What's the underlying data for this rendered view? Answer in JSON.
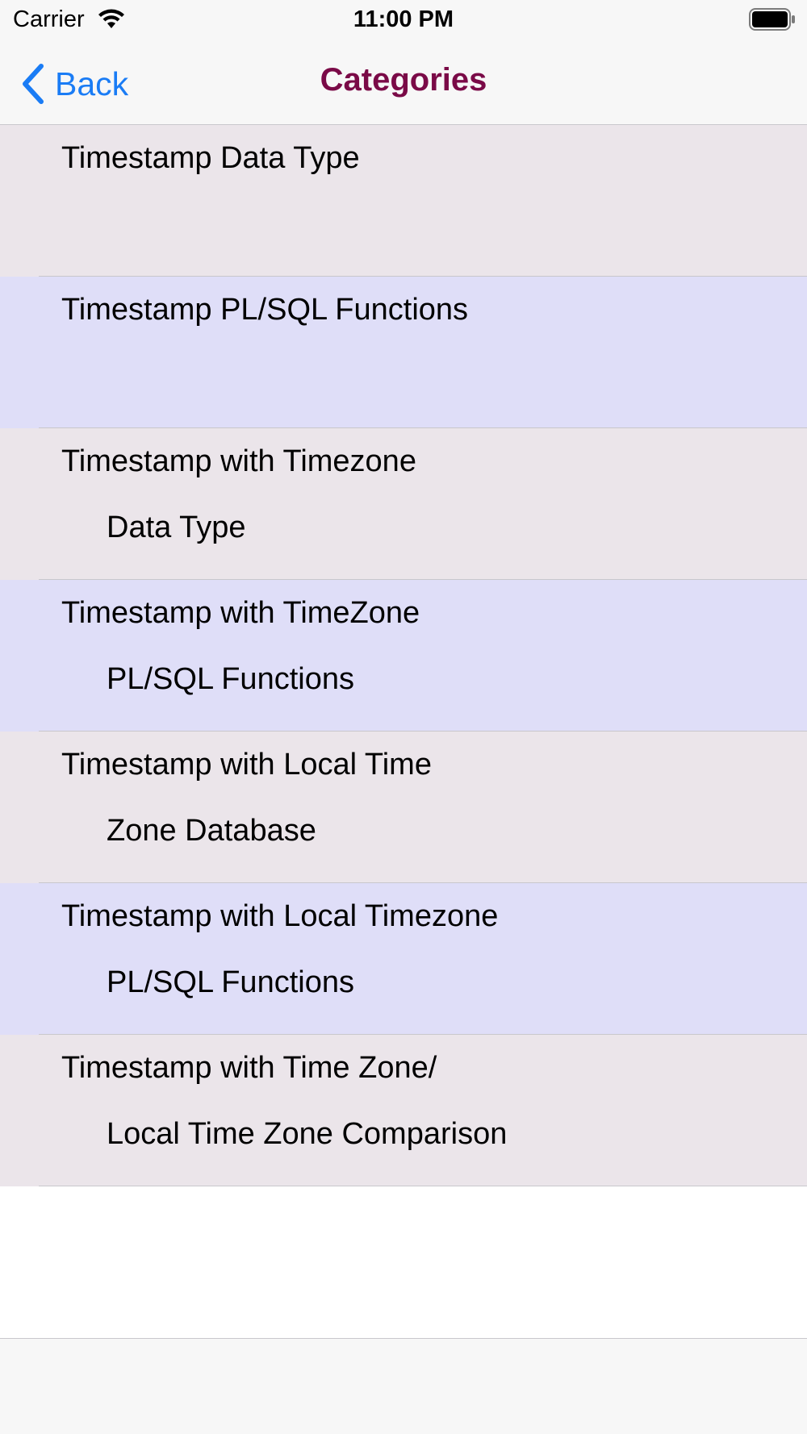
{
  "status_bar": {
    "carrier": "Carrier",
    "time": "11:00 PM"
  },
  "nav": {
    "back_label": "Back",
    "title": "Categories"
  },
  "categories": [
    {
      "line1": "Timestamp Data Type",
      "line2": ""
    },
    {
      "line1": "Timestamp PL/SQL Functions",
      "line2": ""
    },
    {
      "line1": "Timestamp with Timezone",
      "line2": "Data Type"
    },
    {
      "line1": "Timestamp with TimeZone",
      "line2": "PL/SQL Functions"
    },
    {
      "line1": "Timestamp with Local Time",
      "line2": "Zone Database"
    },
    {
      "line1": "Timestamp with Local Timezone",
      "line2": "PL/SQL Functions"
    },
    {
      "line1": "Timestamp with Time Zone/",
      "line2": "Local Time Zone Comparison"
    }
  ],
  "colors": {
    "accent": "#1a7cf5",
    "title": "#7a0a47",
    "row_odd": "#ebe5ea",
    "row_even": "#dfdef8"
  }
}
